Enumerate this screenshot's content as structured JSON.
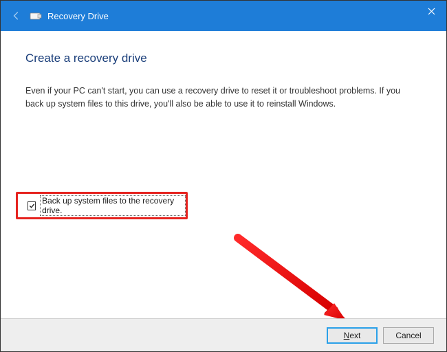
{
  "titlebar": {
    "title": "Recovery Drive"
  },
  "content": {
    "heading": "Create a recovery drive",
    "description": "Even if your PC can't start, you can use a recovery drive to reset it or troubleshoot problems. If you back up system files to this drive, you'll also be able to use it to reinstall Windows."
  },
  "checkbox": {
    "checked": true,
    "label": "Back up system files to the recovery drive."
  },
  "buttons": {
    "next": "Next",
    "cancel": "Cancel"
  }
}
